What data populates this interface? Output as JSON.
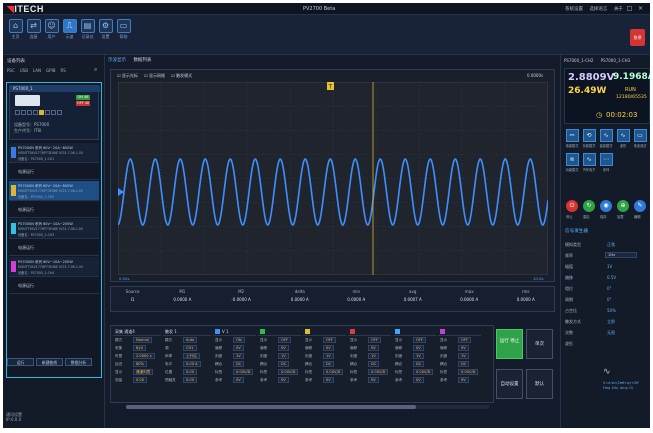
{
  "app": {
    "logo": "ITECH",
    "title": "PV2700 Beta",
    "menu": [
      "系统设置",
      "选择语言",
      "关于"
    ]
  },
  "toolbar": {
    "buttons": [
      {
        "label": "主页",
        "icon": "⌂",
        "selected": false
      },
      {
        "label": "连接",
        "icon": "⇄",
        "selected": false
      },
      {
        "label": "用户",
        "icon": "☺",
        "selected": false
      },
      {
        "label": "示波",
        "icon": "⎍",
        "selected": true
      },
      {
        "label": "记录仪",
        "icon": "▤",
        "selected": false
      },
      {
        "label": "设置",
        "icon": "⚙",
        "selected": false
      },
      {
        "label": "帮助",
        "icon": "▭",
        "selected": false
      }
    ],
    "stop_label": "急停"
  },
  "left": {
    "header": "设备列表",
    "filters": [
      "PSC",
      "USB",
      "LAN",
      "GPIB",
      "RS"
    ],
    "device": {
      "name": "PS7000_1",
      "on_label": "ON 46",
      "off_label": "OFF 40",
      "model_line": "设备型号：PS7000",
      "sn_line": "生产代号：IT6I",
      "keys_on": [
        4
      ]
    },
    "rows": [
      {
        "title": "PS7000N 系列 60V~20A~800W",
        "line2": "MONTT5KV1776P73E46E VLT4-7.06-1.00",
        "line3": "设备名：PS7000_1-CH1",
        "chip": "#3b7be0",
        "selected": false,
        "sub": "电源运行"
      },
      {
        "title": "PS7000N 系列 60V~20A~800W",
        "line2": "MONTT5KV1776P73E46E VLT4-7.06-1.00",
        "line3": "设备名：PS7000_1-CH2",
        "chip": "#e0b630",
        "selected": true,
        "sub": "电源运行"
      },
      {
        "title": "PS7000N 系列 60V~10A~200W",
        "line2": "MONTT5KV1776P73E46E VLT4-7.06-1.00",
        "line3": "设备名：PS7000_1-CH3",
        "chip": "#38c0e0",
        "selected": false,
        "sub": "电源运行"
      },
      {
        "title": "PS7000N 系列 60V~10A~200W",
        "line2": "MONTT5KV1776P73E46E VLT4-7.06-1.00",
        "line3": "设备名：PS7000_1-CH4",
        "chip": "#d03fd8",
        "selected": false,
        "sub": "电源运行"
      }
    ],
    "actions": [
      "运行",
      "新建曲线",
      "数据分析"
    ],
    "footer": [
      "通讯设置",
      "IP:0.0.0"
    ]
  },
  "center": {
    "tabs": [
      "示波显示",
      "数据列表"
    ],
    "scope": {
      "options": [
        "显示光标",
        "显示网格",
        "触发模式"
      ],
      "time_label": "0.0000s",
      "x_start": "0.00s",
      "x_end": "10.0s",
      "trigger_label": "T",
      "wave_color": "#3f8fff"
    },
    "measurements": {
      "headers": [
        "Source",
        "M1",
        "M2",
        "delta",
        "min",
        "avg",
        "max",
        "rms"
      ],
      "rows": [
        [
          "I1",
          "0.0000 A",
          "-0.0000 A",
          "0.0000 A",
          "0.0000 A",
          "0.0007 A",
          "0.0000 A",
          "0.0000 A"
        ]
      ]
    },
    "controls": {
      "cols": [
        {
          "head": "采集 通道4",
          "color": "",
          "rows": [
            [
              "模式",
              "Normal"
            ],
            [
              "采集",
              "ByV"
            ],
            [
              "时基",
              "2.0000 s"
            ],
            [
              "延迟",
              "80%"
            ],
            [
              "显示",
              "通道列表"
            ],
            [
              "测量",
              "0.00"
            ]
          ]
        },
        {
          "head": "触发 1",
          "color": "",
          "rows": [
            [
              "模式",
              "Auto"
            ],
            [
              "源",
              "CH1"
            ],
            [
              "斜率",
              "上升沿"
            ],
            [
              "电平",
              "0.00 A"
            ],
            [
              "位置",
              "0.00"
            ],
            [
              "预触发",
              "0.00"
            ]
          ]
        },
        {
          "head": "V 1",
          "color": "#3f8fff",
          "rows": [
            [
              "显示",
              "ON"
            ],
            [
              "偏移",
              "0V"
            ],
            [
              "刻度",
              "1V"
            ],
            [
              "耦合",
              "DC"
            ],
            [
              "标签",
              "0.00V/D"
            ],
            [
              "参考",
              "0V"
            ]
          ]
        },
        {
          "head": "",
          "color": "#2fbf45",
          "rows": [
            [
              "显示",
              "OFF"
            ],
            [
              "偏移",
              "0V"
            ],
            [
              "刻度",
              "1V"
            ],
            [
              "耦合",
              "DC"
            ],
            [
              "标签",
              "0.00V/D"
            ],
            [
              "参考",
              "0V"
            ]
          ]
        },
        {
          "head": "",
          "color": "#e0c030",
          "rows": [
            [
              "显示",
              "OFF"
            ],
            [
              "偏移",
              "0V"
            ],
            [
              "刻度",
              "1V"
            ],
            [
              "耦合",
              "DC"
            ],
            [
              "标签",
              "0.00V/D"
            ],
            [
              "参考",
              "0V"
            ]
          ]
        },
        {
          "head": "",
          "color": "#e03a3a",
          "rows": [
            [
              "显示",
              "OFF"
            ],
            [
              "偏移",
              "0V"
            ],
            [
              "刻度",
              "1V"
            ],
            [
              "耦合",
              "DC"
            ],
            [
              "标签",
              "0.00V/D"
            ],
            [
              "参考",
              "0V"
            ]
          ]
        },
        {
          "head": "",
          "color": "#3fa7ff",
          "rows": [
            [
              "显示",
              "OFF"
            ],
            [
              "偏移",
              "0V"
            ],
            [
              "刻度",
              "1V"
            ],
            [
              "耦合",
              "DC"
            ],
            [
              "标签",
              "0.00V/D"
            ],
            [
              "参考",
              "0V"
            ]
          ]
        },
        {
          "head": "",
          "color": "#c040d8",
          "rows": [
            [
              "显示",
              "OFF"
            ],
            [
              "偏移",
              "0V"
            ],
            [
              "刻度",
              "1V"
            ],
            [
              "耦合",
              "DC"
            ],
            [
              "标签",
              "0.00V/D"
            ],
            [
              "参考",
              "0V"
            ]
          ]
        }
      ],
      "run_label": "运行 停止",
      "single_label": "单次",
      "auto_label": "自动设置",
      "default_label": "默认"
    }
  },
  "right": {
    "tabs": [
      "PS7000_1-CH2",
      "PS7000_1-CH3"
    ],
    "voltage": "2.8809V",
    "current": "9.1968A",
    "power": "26.49W",
    "state": "RUN",
    "counter": "12180/65535",
    "clock_icon": "clock-icon",
    "time": "00:02:03",
    "modes": [
      {
        "label": "电源模式",
        "icon": "⎓"
      },
      {
        "label": "负载模式",
        "icon": "⟲"
      },
      {
        "label": "曲线模式",
        "icon": "∿"
      },
      {
        "label": "波形",
        "icon": "∿"
      },
      {
        "label": "电池测试",
        "icon": "▭"
      },
      {
        "label": "功能模式",
        "icon": "≋"
      },
      {
        "label": "汽车电子",
        "icon": "∿"
      },
      {
        "label": "序列",
        "icon": "⋯"
      }
    ],
    "circles": [
      {
        "label": "停止",
        "icon": "⏻",
        "color": "#d63434"
      },
      {
        "label": "重启",
        "icon": "↻",
        "color": "#2fa24a"
      },
      {
        "label": "保存",
        "icon": "◉",
        "color": "#2f7ad6"
      },
      {
        "label": "加载",
        "icon": "⊕",
        "color": "#2fa24a"
      },
      {
        "label": "编辑",
        "icon": "✎",
        "color": "#2f7ad6"
      }
    ],
    "param_title": "信号发生器",
    "params": [
      {
        "label": "模拟类型",
        "value": "正弦"
      },
      {
        "label": "频率",
        "value": "",
        "box": "1Hz"
      },
      {
        "label": "幅值",
        "value": "1V"
      },
      {
        "label": "偏移",
        "value": "0.5V"
      },
      {
        "label": "相位",
        "value": "0°"
      },
      {
        "label": "周期",
        "value": "0°"
      },
      {
        "label": "占空比",
        "value": "50%"
      },
      {
        "label": "触发方式",
        "value": "立即"
      },
      {
        "label": "次数",
        "value": "无限"
      },
      {
        "label": "波形",
        "value": ""
      }
    ],
    "wave_desc": [
      "V=A·sin(2πft+φ)+Off",
      "Freq 1Hz, Amp 1V"
    ]
  }
}
